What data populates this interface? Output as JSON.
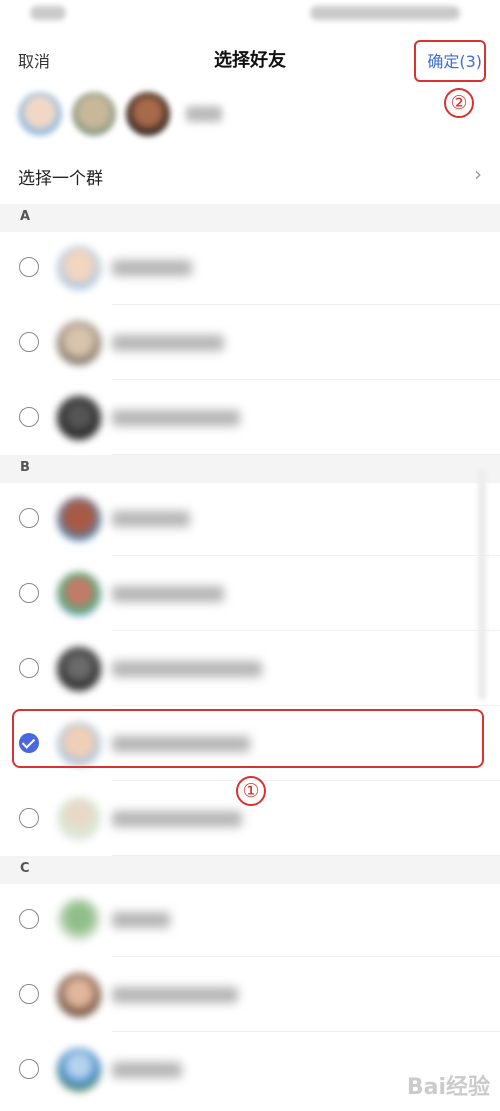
{
  "nav": {
    "cancel": "取消",
    "title": "选择好友",
    "confirm": "确定(3)"
  },
  "group_row": {
    "label": "选择一个群",
    "chevron": "›"
  },
  "sections": [
    {
      "letter": "A",
      "rows": [
        {
          "checked": false
        },
        {
          "checked": false
        },
        {
          "checked": false
        }
      ]
    },
    {
      "letter": "B",
      "rows": [
        {
          "checked": false
        },
        {
          "checked": false
        },
        {
          "checked": false
        },
        {
          "checked": true
        },
        {
          "checked": false
        }
      ]
    },
    {
      "letter": "C",
      "rows": [
        {
          "checked": false
        },
        {
          "checked": false
        },
        {
          "checked": false
        }
      ]
    }
  ],
  "annotations": {
    "step1": "①",
    "step2": "②"
  },
  "watermark": "Bai经验",
  "colors": {
    "accent": "#4a66e0",
    "confirm_text": "#3b6fd4",
    "annotation": "#d9322f",
    "section_bg": "#f4f4f4"
  }
}
